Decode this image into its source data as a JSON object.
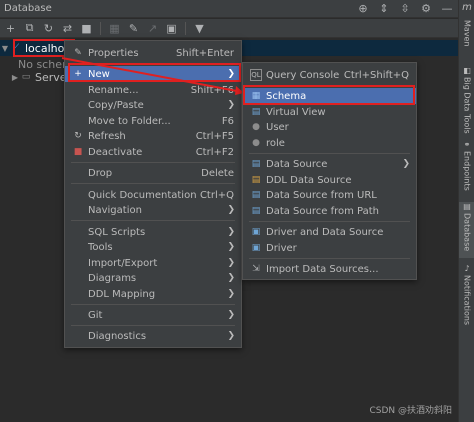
{
  "window": {
    "title": "Database"
  },
  "titlebar_icons": [
    {
      "name": "crosshair-icon",
      "glyph": "⊕"
    },
    {
      "name": "expand-icon",
      "glyph": "⇕"
    },
    {
      "name": "collapse-icon",
      "glyph": "⇳"
    },
    {
      "name": "gear-icon",
      "glyph": "⚙"
    },
    {
      "name": "minimize-icon",
      "glyph": "—"
    }
  ],
  "corner_label": "m",
  "tree": {
    "root_label": "localhos",
    "child1_label": "No schem",
    "child2_label": "Serve"
  },
  "context_menu": {
    "items": [
      {
        "label": "Properties",
        "shortcut": "Shift+Enter",
        "icon": "✎"
      },
      {
        "label": "New",
        "shortcut": "",
        "icon": "+"
      },
      {
        "label": "Rename...",
        "shortcut": "Shift+F6",
        "icon": ""
      },
      {
        "label": "Copy/Paste",
        "shortcut": "",
        "icon": ""
      },
      {
        "label": "Move to Folder...",
        "shortcut": "F6",
        "icon": ""
      },
      {
        "label": "Refresh",
        "shortcut": "Ctrl+F5",
        "icon": "↻"
      },
      {
        "label": "Deactivate",
        "shortcut": "Ctrl+F2",
        "icon": "■"
      },
      {
        "label": "Drop",
        "shortcut": "Delete",
        "icon": ""
      },
      {
        "label": "Quick Documentation",
        "shortcut": "Ctrl+Q",
        "icon": ""
      },
      {
        "label": "Navigation",
        "shortcut": "",
        "icon": ""
      },
      {
        "label": "SQL Scripts",
        "shortcut": "",
        "icon": ""
      },
      {
        "label": "Tools",
        "shortcut": "",
        "icon": ""
      },
      {
        "label": "Import/Export",
        "shortcut": "",
        "icon": ""
      },
      {
        "label": "Diagrams",
        "shortcut": "",
        "icon": ""
      },
      {
        "label": "DDL Mapping",
        "shortcut": "",
        "icon": ""
      },
      {
        "label": "Git",
        "shortcut": "",
        "icon": ""
      },
      {
        "label": "Diagnostics",
        "shortcut": "",
        "icon": ""
      }
    ]
  },
  "submenu": {
    "items": [
      {
        "label": "Query Console",
        "shortcut": "Ctrl+Shift+Q",
        "icon": "QL"
      },
      {
        "label": "Schema",
        "shortcut": "",
        "icon": "▦"
      },
      {
        "label": "Virtual View",
        "shortcut": "",
        "icon": "▤"
      },
      {
        "label": "User",
        "shortcut": "",
        "icon": "●"
      },
      {
        "label": "role",
        "shortcut": "",
        "icon": "●"
      },
      {
        "label": "Data Source",
        "shortcut": "",
        "icon": "▤"
      },
      {
        "label": "DDL Data Source",
        "shortcut": "",
        "icon": "▤"
      },
      {
        "label": "Data Source from URL",
        "shortcut": "",
        "icon": "▤"
      },
      {
        "label": "Data Source from Path",
        "shortcut": "",
        "icon": "▤"
      },
      {
        "label": "Driver and Data Source",
        "shortcut": "",
        "icon": "▣"
      },
      {
        "label": "Driver",
        "shortcut": "",
        "icon": "▣"
      },
      {
        "label": "Import Data Sources...",
        "shortcut": "",
        "icon": "⇲"
      }
    ]
  },
  "sidebar": {
    "tabs": [
      {
        "label": "Maven",
        "icon": ""
      },
      {
        "label": "Big Data Tools",
        "icon": "◧"
      },
      {
        "label": "Endpoints",
        "icon": "⚭"
      },
      {
        "label": "Database",
        "icon": "▤"
      },
      {
        "label": "Notifications",
        "icon": "🔔"
      }
    ]
  },
  "watermark": "CSDN @扶酒劝斜阳",
  "colors": {
    "highlight": "#4b6eaf",
    "annotation_red": "#e02020",
    "background": "#2b2b2b",
    "panel": "#3c3f41"
  }
}
